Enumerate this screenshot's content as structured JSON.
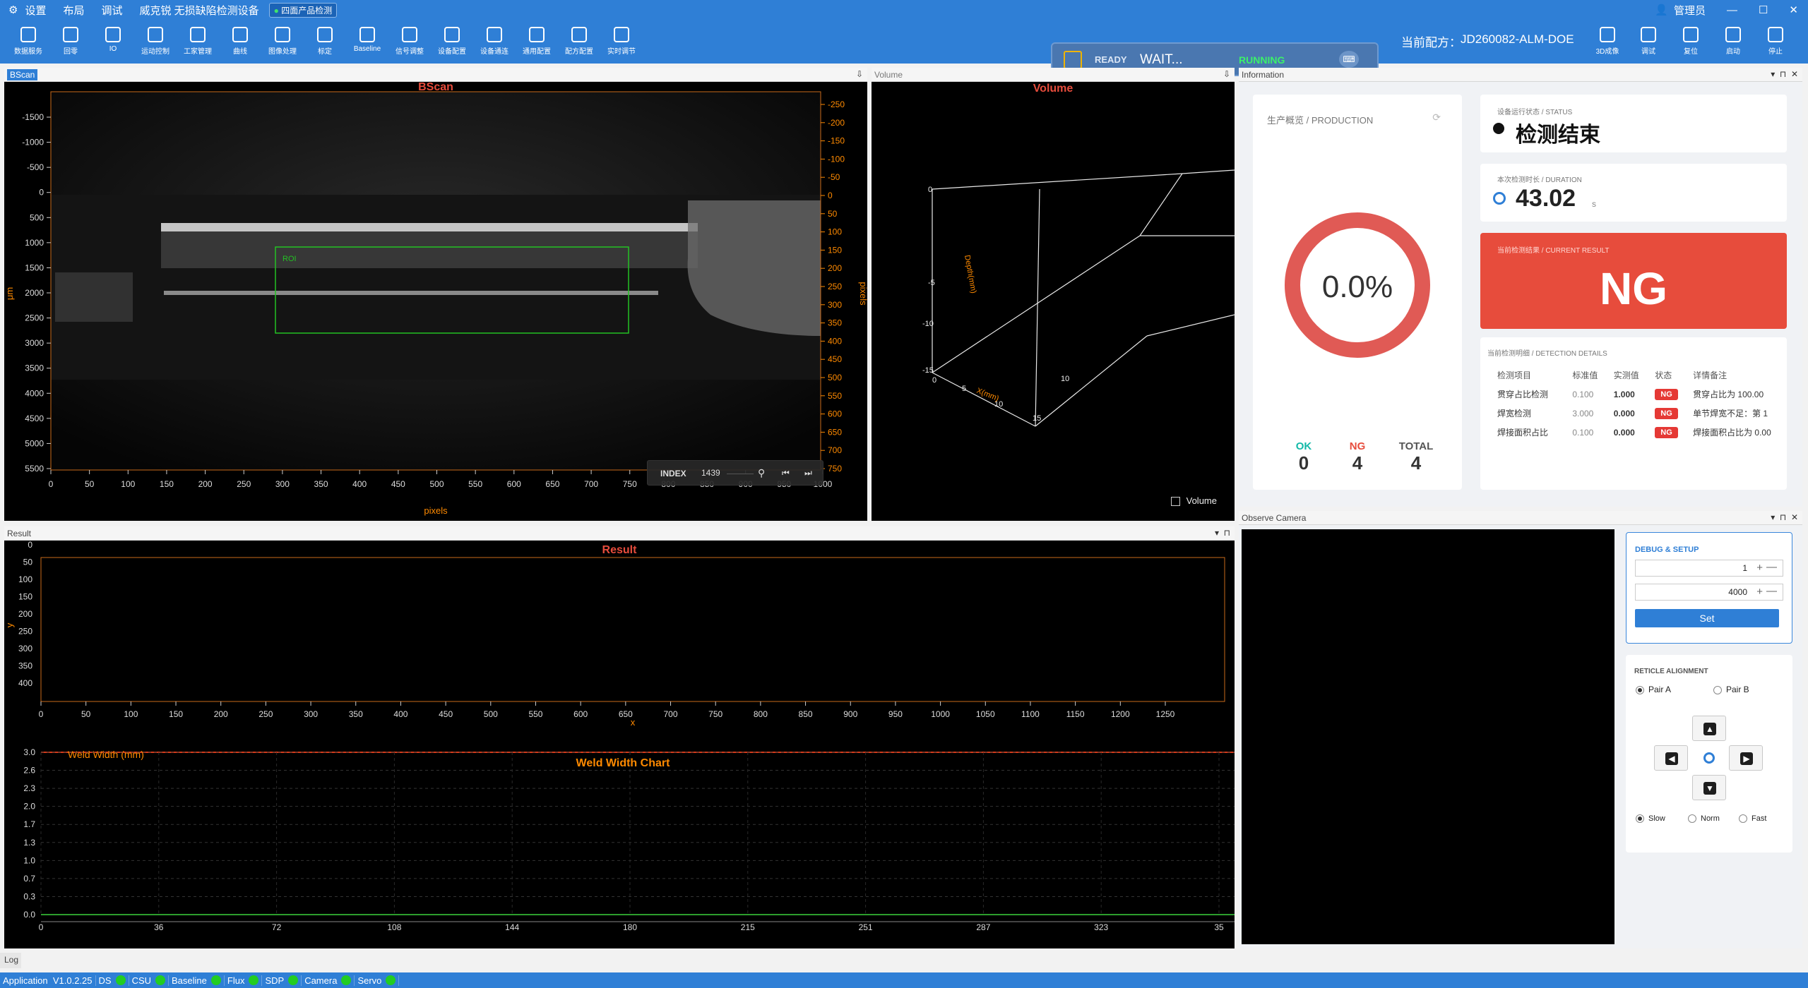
{
  "titlebar": {
    "menu": [
      "设置",
      "布局",
      "调试"
    ],
    "app_title": "威克锐 无损缺陷检测设备",
    "mode_badge": "四面产品检测",
    "user": "管理员"
  },
  "toolbar": {
    "tools": [
      {
        "label": "数据服务",
        "icon": "grid-icon"
      },
      {
        "label": "回零",
        "icon": "home-icon"
      },
      {
        "label": "IO",
        "icon": "link-icon"
      },
      {
        "label": "运动控制",
        "icon": "robot-icon"
      },
      {
        "label": "工家管理",
        "icon": "sliders-icon"
      },
      {
        "label": "曲线",
        "icon": "curve-icon"
      },
      {
        "label": "图像处理",
        "icon": "adjust-icon"
      },
      {
        "label": "标定",
        "icon": "target-icon"
      },
      {
        "label": "Baseline",
        "icon": "baseline-icon"
      },
      {
        "label": "信号调整",
        "icon": "contrast-icon"
      },
      {
        "label": "设备配置",
        "icon": "gear-icon"
      },
      {
        "label": "设备通连",
        "icon": "chain-icon"
      },
      {
        "label": "通用配置",
        "icon": "wrench-icon"
      },
      {
        "label": "配方配置",
        "icon": "recipe-icon"
      },
      {
        "label": "实时调节",
        "icon": "terminal-icon"
      }
    ],
    "right_tools": [
      {
        "label": "3D成像",
        "icon": "cube-icon"
      },
      {
        "label": "调试",
        "icon": "monitor-icon"
      },
      {
        "label": "复位",
        "icon": "reset-icon"
      },
      {
        "label": "启动",
        "icon": "play-icon"
      },
      {
        "label": "停止",
        "icon": "stop-icon"
      }
    ]
  },
  "status_widget": {
    "ready": "READY",
    "wait": "WAIT...",
    "running": "RUNNING"
  },
  "recipe": {
    "label": "当前配方：",
    "value": "JD260082-ALM-DOE"
  },
  "bscan": {
    "tab": "BScan",
    "title": "BScan",
    "left_unit": "μm",
    "right_unit": "pixels",
    "x_unit": "pixels",
    "left_ticks": [
      "-1500",
      "-1000",
      "-500",
      "0",
      "500",
      "1000",
      "1500",
      "2000",
      "2500",
      "3000",
      "3500",
      "4000",
      "4500",
      "5000",
      "5500"
    ],
    "right_ticks": [
      "-250",
      "-200",
      "-150",
      "-100",
      "-50",
      "0",
      "50",
      "100",
      "150",
      "200",
      "250",
      "300",
      "350",
      "400",
      "450",
      "500",
      "550",
      "600",
      "650",
      "700",
      "750"
    ],
    "x_ticks": [
      "0",
      "50",
      "100",
      "150",
      "200",
      "250",
      "300",
      "350",
      "400",
      "450",
      "500",
      "550",
      "600",
      "650",
      "700",
      "750",
      "800",
      "850",
      "900",
      "950",
      "1000"
    ],
    "roi_label": "ROI",
    "index_label": "INDEX",
    "index_value": "1439"
  },
  "volume": {
    "tab": "Volume",
    "title": "Volume",
    "ylabel": "Depth(mm)",
    "xlabel": "X(mm)",
    "y_ticks": [
      "0",
      "-5",
      "-10",
      "-15"
    ],
    "x_ticks": [
      "0",
      "5",
      "10",
      "15"
    ],
    "z_ticks": [
      "10"
    ],
    "checkbox_label": "Volume"
  },
  "information": {
    "header": "Information",
    "production_title": "生产概览 / PRODUCTION",
    "rate": "0.0%",
    "rate_fraction": 0.0,
    "ok_label": "OK",
    "ok_value": "0",
    "ng_label": "NG",
    "ng_value": "4",
    "total_label": "TOTAL",
    "total_value": "4",
    "status_caption": "设备运行状态 / STATUS",
    "status_text": "检测结束",
    "duration_caption": "本次检测时长 / DURATION",
    "duration_value": "43.02",
    "duration_unit": "s",
    "result_caption": "当前检测结果 / CURRENT RESULT",
    "result_value": "NG",
    "details_caption": "当前检测明细 / DETECTION DETAILS",
    "details_headers": [
      "检测项目",
      "标准值",
      "实测值",
      "状态",
      "详情备注"
    ],
    "details_rows": [
      [
        "贯穿占比检测",
        "0.100",
        "1.000",
        "NG",
        "贯穿占比为 100.00"
      ],
      [
        "焊宽检测",
        "3.000",
        "0.000",
        "NG",
        "单节焊宽不足：第 1"
      ],
      [
        "焊接面积占比",
        "0.100",
        "0.000",
        "NG",
        "焊接面积占比为 0.00"
      ]
    ]
  },
  "result_panel": {
    "header": "Result",
    "title": "Result",
    "ylabel": "y",
    "xlabel": "x",
    "y_ticks": [
      "0",
      "50",
      "100",
      "150",
      "200",
      "250",
      "300",
      "350",
      "400"
    ],
    "x_ticks": [
      "0",
      "50",
      "100",
      "150",
      "200",
      "250",
      "300",
      "350",
      "400",
      "450",
      "500",
      "550",
      "600",
      "650",
      "700",
      "750",
      "800",
      "850",
      "900",
      "950",
      "1000",
      "1050",
      "1100",
      "1150",
      "1200",
      "1250"
    ]
  },
  "weld_chart": {
    "title": "Weld Width Chart",
    "ylabel": "Weld Width (mm)",
    "y_ticks": [
      "3.0",
      "2.6",
      "2.3",
      "2.0",
      "1.7",
      "1.3",
      "1.0",
      "0.7",
      "0.3",
      "0.0"
    ],
    "x_ticks": [
      "0",
      "36",
      "72",
      "108",
      "144",
      "180",
      "215",
      "251",
      "287",
      "323",
      "35"
    ]
  },
  "chart_data": [
    {
      "type": "line",
      "title": "Weld Width Chart",
      "ylabel": "Weld Width (mm)",
      "x": [
        0,
        358
      ],
      "series": [
        {
          "values": [
            0.0,
            0.0
          ]
        }
      ],
      "ylim": [
        0.0,
        3.0
      ],
      "xlim": [
        0,
        358
      ],
      "grid": true
    }
  ],
  "camera": {
    "header": "Observe Camera",
    "debug_title": "DEBUG & SETUP",
    "field1": "1",
    "field2": "4000",
    "set_label": "Set",
    "reticle_title": "RETICLE ALIGNMENT",
    "pair_a": "Pair A",
    "pair_b": "Pair B",
    "speed_slow": "Slow",
    "speed_norm": "Norm",
    "speed_fast": "Fast"
  },
  "log": {
    "tab": "Log"
  },
  "statusbar": {
    "app": "Application",
    "version": "V1.0.2.25",
    "items": [
      "DS",
      "CSU",
      "Baseline",
      "Flux",
      "SDP",
      "Camera",
      "Servo"
    ]
  },
  "colors": {
    "accent": "#2f7fd6",
    "ng": "#e74c3c",
    "ok": "#13b9a8",
    "chart_orange": "#ff8a00",
    "roi_green": "#23c223"
  }
}
